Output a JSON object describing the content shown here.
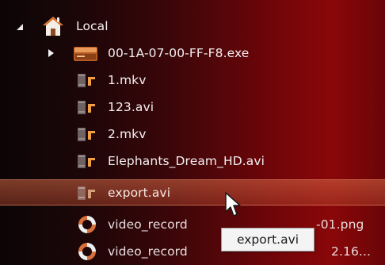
{
  "tree": {
    "root": {
      "label": "Local",
      "expanded": true,
      "icon": "home-icon"
    },
    "items": [
      {
        "label": "00-1A-07-00-FF-F8.exe",
        "icon": "drive-folder-icon",
        "expandable": true,
        "selected": false
      },
      {
        "label": "1.mkv",
        "icon": "video-file-icon",
        "selected": false
      },
      {
        "label": "123.avi",
        "icon": "video-file-icon",
        "selected": false
      },
      {
        "label": "2.mkv",
        "icon": "video-file-icon",
        "selected": false
      },
      {
        "label": "Elephants_Dream_HD.avi",
        "icon": "video-file-icon",
        "selected": false
      },
      {
        "label": "export.avi",
        "icon": "video-file-icon",
        "selected": true
      },
      {
        "label": "video_record",
        "icon": "recording-icon",
        "selected": false
      },
      {
        "label": "video_record",
        "icon": "recording-icon",
        "selected": false
      }
    ],
    "partial_suffixes": {
      "row7": "-01.png",
      "row8": "2.16..."
    }
  },
  "tooltip": {
    "text": "export.avi"
  },
  "colors": {
    "selection": "#c8583a",
    "background_accent": "#8a0709",
    "icon_orange": "#f0a040"
  }
}
